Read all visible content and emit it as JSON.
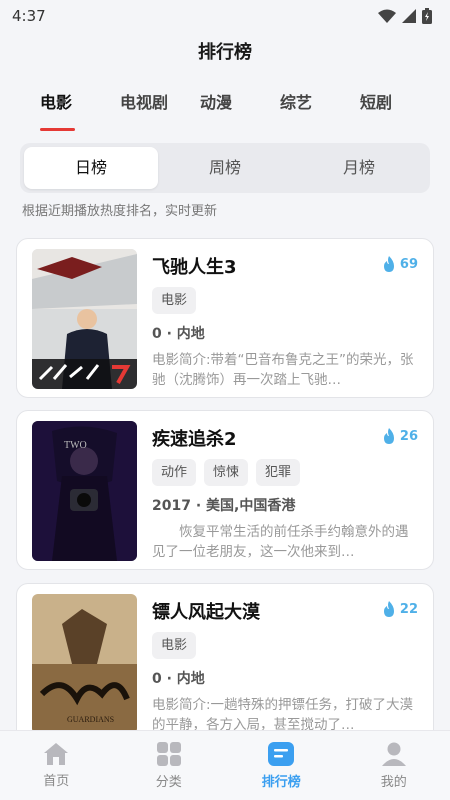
{
  "status": {
    "time": "4:37"
  },
  "header": {
    "title": "排行榜"
  },
  "category_tabs": [
    "电影",
    "电视剧",
    "动漫",
    "综艺",
    "短剧"
  ],
  "segments": [
    "日榜",
    "周榜",
    "月榜"
  ],
  "hint": "根据近期播放热度排名，实时更新",
  "movies": [
    {
      "title": "飞驰人生3",
      "heat": "69",
      "tags": [
        "电影"
      ],
      "meta": "0 · 内地",
      "desc": "电影简介:带着“巴音布鲁克之王”的荣光，张驰（沈腾饰）再一次踏上飞驰…"
    },
    {
      "title": "疾速追杀2",
      "heat": "26",
      "tags": [
        "动作",
        "惊悚",
        "犯罪"
      ],
      "meta": "2017 · 美国,中国香港",
      "desc": "　　恢复平常生活的前任杀手约翰意外的遇见了一位老朋友，这一次他来到…"
    },
    {
      "title": "镖人风起大漠",
      "heat": "22",
      "tags": [
        "电影"
      ],
      "meta": "0 · 内地",
      "desc": "电影简介:一趟特殊的押镖任务，打破了大漠的平静，各方入局，甚至搅动了…"
    }
  ],
  "bottom_nav": [
    "首页",
    "分类",
    "排行榜",
    "我的"
  ],
  "colors": {
    "accent": "#3b9ff0",
    "tab_underline": "#e53935",
    "heat": "#4fb0e8"
  }
}
